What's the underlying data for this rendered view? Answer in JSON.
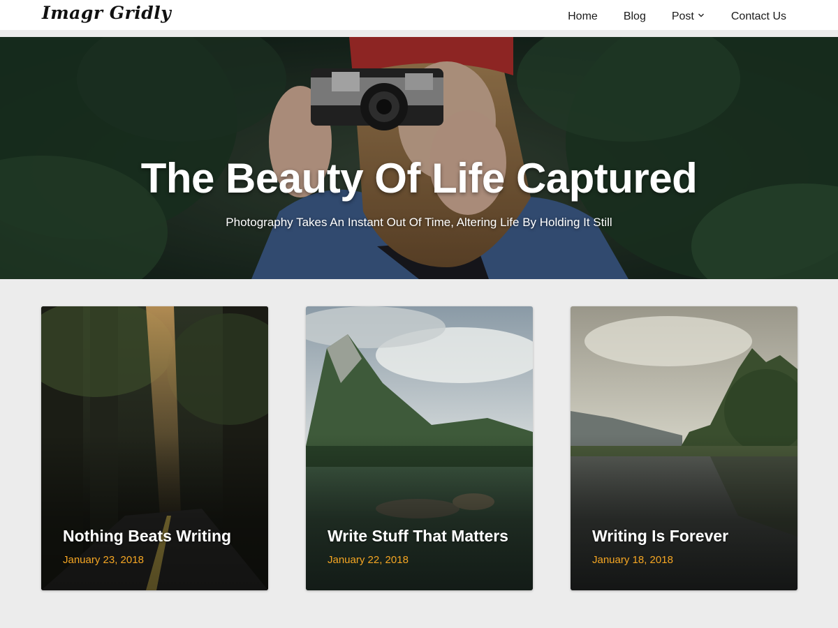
{
  "site": {
    "logo": "Imagr Gridly"
  },
  "nav": {
    "items": [
      {
        "label": "Home"
      },
      {
        "label": "Blog"
      },
      {
        "label": "Post",
        "has_dropdown": true,
        "icon": "chevron-down-icon"
      },
      {
        "label": "Contact Us"
      }
    ]
  },
  "hero": {
    "title": "The Beauty Of Life Captured",
    "subtitle": "Photography Takes An Instant Out Of Time, Altering Life By Holding It Still"
  },
  "posts": [
    {
      "title": "Nothing Beats Writing",
      "date": "January 23, 2018"
    },
    {
      "title": "Write Stuff That Matters",
      "date": "January 22, 2018"
    },
    {
      "title": "Writing Is Forever",
      "date": "January 18, 2018"
    }
  ],
  "colors": {
    "date_accent": "#f5a623",
    "page_background": "#ececec",
    "header_background": "#ffffff"
  }
}
